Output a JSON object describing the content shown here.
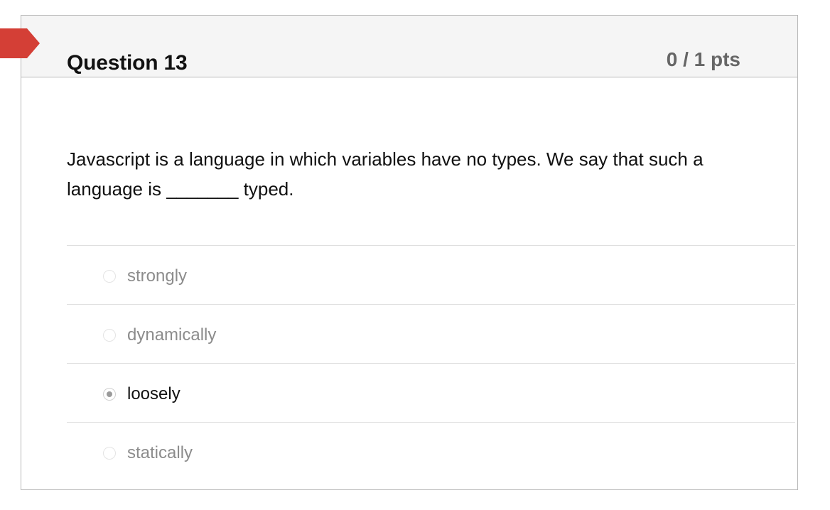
{
  "question": {
    "title": "Question 13",
    "points": "0 / 1 pts",
    "text": "Javascript is a language in which variables have no types. We say that such a language is _______ typed.",
    "flag_color": "#d43f36"
  },
  "answers": [
    {
      "label": "strongly",
      "selected": false
    },
    {
      "label": "dynamically",
      "selected": false
    },
    {
      "label": "loosely",
      "selected": true
    },
    {
      "label": "statically",
      "selected": false
    }
  ]
}
